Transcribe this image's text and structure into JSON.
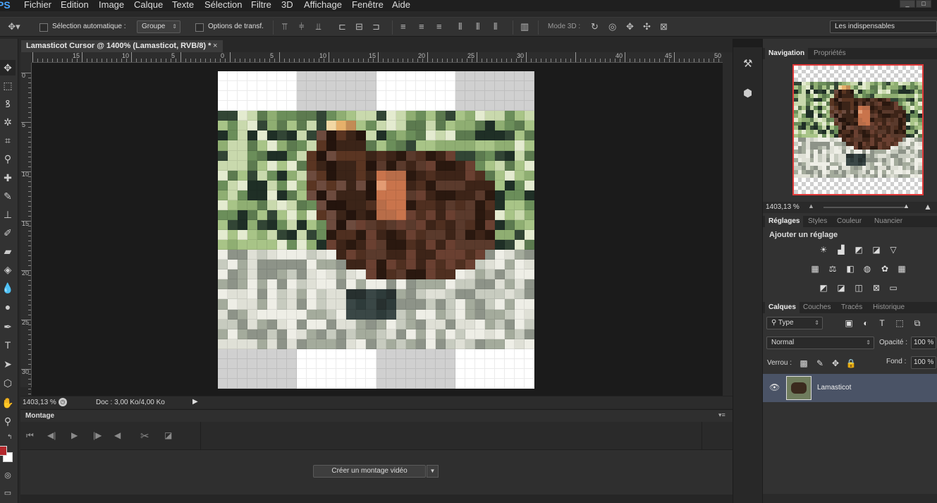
{
  "app": {
    "logo": "PS"
  },
  "menu": [
    "Fichier",
    "Edition",
    "Image",
    "Calque",
    "Texte",
    "Sélection",
    "Filtre",
    "3D",
    "Affichage",
    "Fenêtre",
    "Aide"
  ],
  "window_controls": [
    "_",
    "□",
    "×"
  ],
  "options": {
    "auto_select_label": "Sélection automatique :",
    "auto_select_value": "Groupe",
    "transform_label": "Options de transf.",
    "mode3d_label": "Mode 3D :",
    "workspace": "Les indispensables"
  },
  "document": {
    "tab_title": "Lamasticot Cursor @ 1400% (Lamasticot, RVB/8) *",
    "close": "×"
  },
  "ruler": {
    "h_labels": [
      "15",
      "10",
      "5",
      "0",
      "5",
      "10",
      "15",
      "20",
      "25",
      "30",
      "40",
      "45",
      "50"
    ],
    "v_labels": [
      "0",
      "5",
      "10",
      "15",
      "20",
      "25",
      "30"
    ]
  },
  "status": {
    "zoom": "1403,13 %",
    "doc": "Doc : 3,00 Ko/4,00 Ko"
  },
  "montage": {
    "title": "Montage",
    "create_button": "Créer un montage vidéo"
  },
  "navigator": {
    "tabs": [
      "Navigation",
      "Propriétés"
    ],
    "zoom": "1403,13 %"
  },
  "adjustments": {
    "tabs": [
      "Réglages",
      "Styles",
      "Couleur",
      "Nuancier"
    ],
    "title": "Ajouter un réglage",
    "icons": [
      "brightness-icon",
      "levels-icon",
      "curves-icon",
      "exposure-icon",
      "vibrance-icon",
      "hue-saturation-icon",
      "color-balance-icon",
      "black-white-icon",
      "photo-filter-icon",
      "channel-mixer-icon",
      "color-lookup-icon",
      "invert-icon",
      "posterize-icon",
      "threshold-icon",
      "gradient-map-icon",
      "selective-color-icon"
    ]
  },
  "layers": {
    "tabs": [
      "Calques",
      "Couches",
      "Tracés",
      "Historique"
    ],
    "filter": "Type",
    "blend_mode": "Normal",
    "opacity_label": "Opacité :",
    "opacity": "100 %",
    "lock_label": "Verrou :",
    "fill_label": "Fond :",
    "fill": "100 %",
    "layer_name": "Lamasticot"
  },
  "colors": {
    "foreground": "#b3282c",
    "background": "#ffffff",
    "accent": "#4aa6ff",
    "selection_row": "#4a5366"
  }
}
